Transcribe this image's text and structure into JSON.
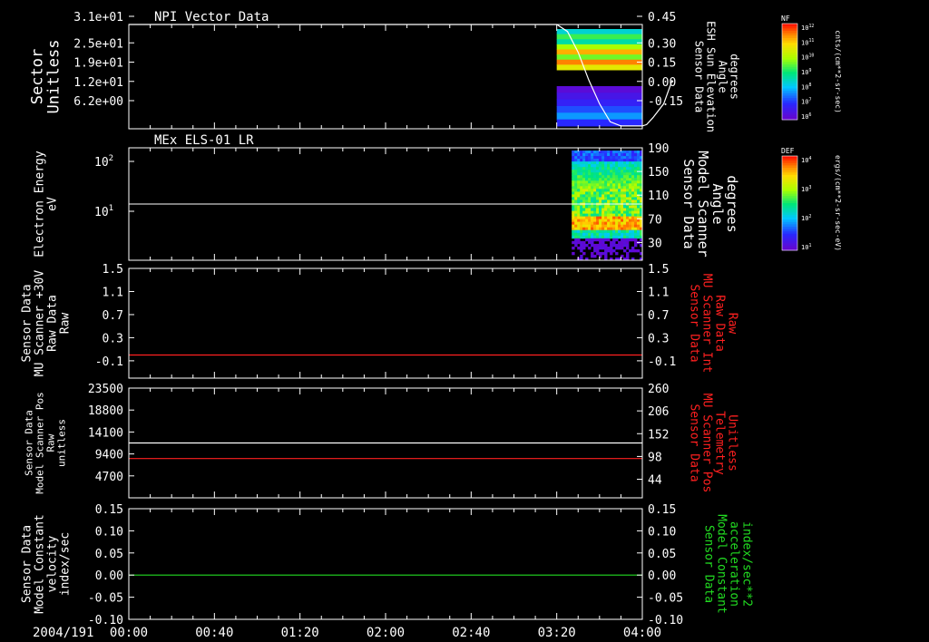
{
  "date_label": "2004/191",
  "time_ticks": [
    "00:00",
    "00:40",
    "01:20",
    "02:00",
    "02:40",
    "03:20",
    "04:00"
  ],
  "colors": {
    "white": "#ffffff",
    "red": "#ff2020",
    "green": "#22dd22",
    "black": "#000000"
  },
  "chart_data": [
    {
      "type": "heatmap",
      "title": "NPI Vector Data",
      "ylabel": [
        "Sector",
        "Unitless"
      ],
      "yticks": [
        "3.1e+01",
        "2.5e+01",
        "1.9e+01",
        "1.2e+01",
        "6.2e+00"
      ],
      "ylim": [
        0,
        31
      ],
      "y2label": [
        "Sensor Data",
        "ESH Sun Elevation",
        "Angle",
        "degrees"
      ],
      "y2ticks": [
        "0.45",
        "0.30",
        "0.15",
        "0.00",
        "-0.15"
      ],
      "y2lim": [
        -0.3,
        0.45
      ],
      "y2_line": [
        [
          0,
          0.45
        ],
        [
          200,
          0.45
        ],
        [
          205,
          0.4
        ],
        [
          210,
          0.25
        ],
        [
          215,
          0.05
        ],
        [
          220,
          -0.12
        ],
        [
          225,
          -0.25
        ],
        [
          230,
          -0.28
        ],
        [
          235,
          -0.28
        ],
        [
          240,
          -0.28
        ],
        [
          242,
          -0.27
        ],
        [
          245,
          -0.22
        ],
        [
          250,
          -0.12
        ],
        [
          254,
          0.05
        ]
      ],
      "colorbar": {
        "label": "NF",
        "unit": "cnts/(cm**2-sr-sec)",
        "ticks": [
          "10^12",
          "10^11",
          "10^10",
          "10^9",
          "10^8",
          "10^7",
          "10^6"
        ]
      }
    },
    {
      "type": "heatmap",
      "title": "MEx ELS-01 LR",
      "ylabel": [
        "Electron Energy",
        "eV"
      ],
      "yticks": [
        "10^2",
        "10^1"
      ],
      "ylog": true,
      "y2label": [
        "Sensor Data",
        "Model Scanner",
        "Angle",
        "degrees"
      ],
      "y2ticks": [
        "190",
        "150",
        "110",
        "70",
        "30"
      ],
      "y2lim": [
        0,
        190
      ],
      "y2_line_value": 110,
      "colorbar": {
        "label": "DEF",
        "unit": "ergs/(cm**2-sr-sec-eV)",
        "ticks": [
          "10^4",
          "10^3",
          "10^2",
          "10^1"
        ]
      }
    },
    {
      "type": "line",
      "ylabel": [
        "Sensor Data",
        "MU Scanner +30V",
        "Raw Data",
        "Raw"
      ],
      "yticks": [
        "1.5",
        "1.1",
        "0.7",
        "0.3",
        "-0.1"
      ],
      "ylim": [
        -0.4,
        1.5
      ],
      "y2label": [
        "Sensor Data",
        "MU Scanner Int",
        "Raw Data",
        "Raw"
      ],
      "y2ticks": [
        "1.5",
        "1.1",
        "0.7",
        "0.3",
        "-0.1"
      ],
      "y2lim": [
        -0.4,
        1.5
      ],
      "series": [
        {
          "color": "red",
          "value": 0.0
        }
      ]
    },
    {
      "type": "line",
      "ylabel": [
        "Sensor Data",
        "Model Scanner Pos",
        "Raw",
        "unitless"
      ],
      "yticks": [
        "23500",
        "18800",
        "14100",
        "9400",
        "4700"
      ],
      "ylim": [
        0,
        23500
      ],
      "y2label": [
        "Sensor Data",
        "MU Scanner Pos",
        "Telemetry",
        "Unitless"
      ],
      "y2ticks": [
        "260",
        "206",
        "152",
        "98",
        "44"
      ],
      "y2lim": [
        0,
        260
      ],
      "series": [
        {
          "color": "white",
          "value": 11750
        },
        {
          "color": "red",
          "value": 8400
        }
      ]
    },
    {
      "type": "line",
      "ylabel": [
        "Sensor Data",
        "Model Constant",
        "velocity",
        "index/sec"
      ],
      "yticks": [
        "0.15",
        "0.10",
        "0.05",
        "0.00",
        "-0.05",
        "-0.10"
      ],
      "ylim": [
        -0.1,
        0.15
      ],
      "y2label": [
        "Sensor Data",
        "Model Constant",
        "acceleration",
        "index/sec**2"
      ],
      "y2ticks": [
        "0.15",
        "0.10",
        "0.05",
        "0.00",
        "-0.05",
        "-0.10"
      ],
      "y2lim": [
        -0.1,
        0.15
      ],
      "series": [
        {
          "color": "green",
          "value": 0.0
        }
      ]
    }
  ]
}
